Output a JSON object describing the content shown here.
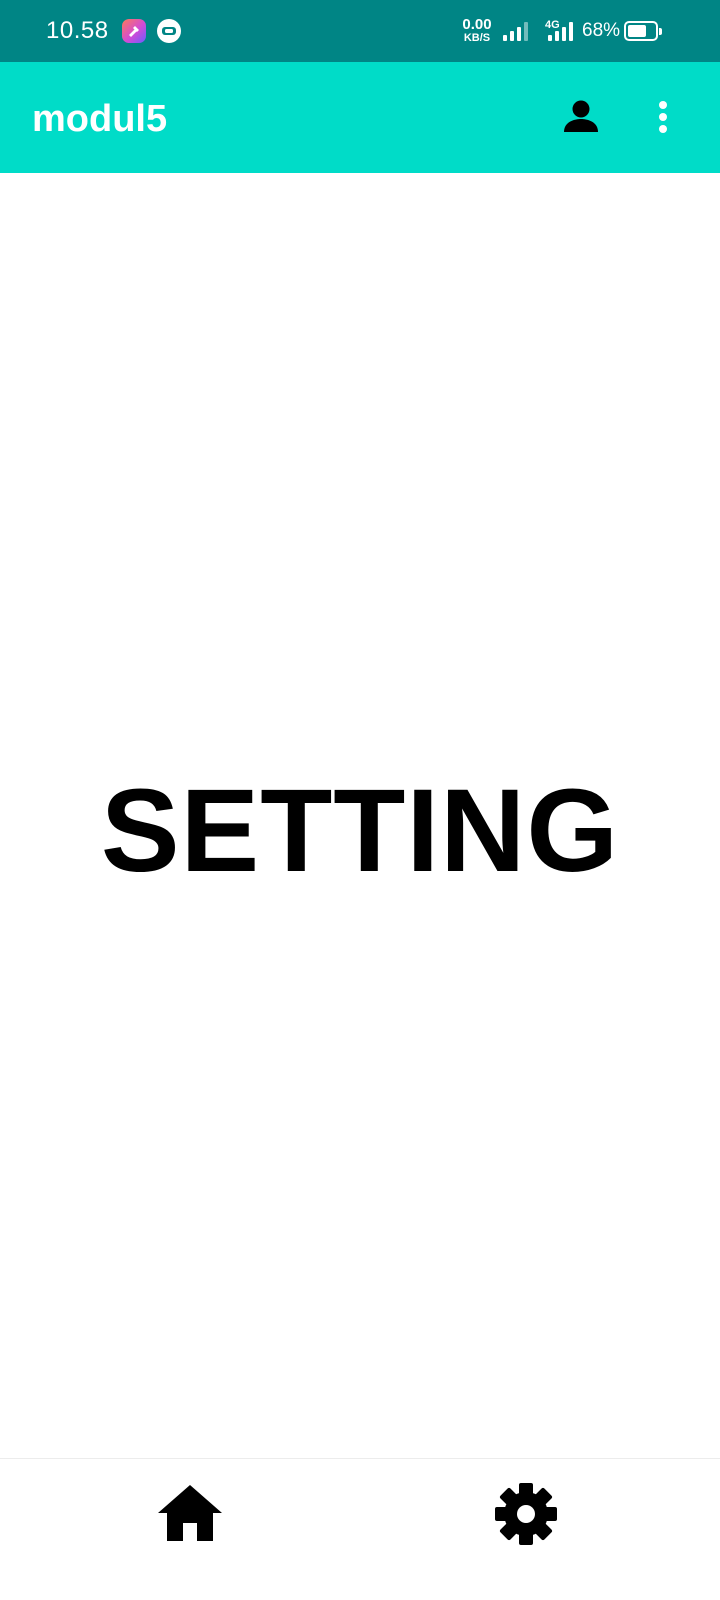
{
  "status_bar": {
    "time": "10.58",
    "net_speed_value": "0.00",
    "net_speed_unit": "KB/S",
    "network_type": "4G",
    "battery_percent": "68%",
    "battery_level": 0.68,
    "icons": [
      "app-notification-icon",
      "messaging-notification-icon",
      "signal-icon",
      "signal-4g-icon",
      "battery-icon"
    ]
  },
  "app_bar": {
    "title": "modul5",
    "actions": [
      "person-icon",
      "more-vert-icon"
    ],
    "color": "#00dcc8"
  },
  "main": {
    "heading": "SETTING"
  },
  "bottom_nav": {
    "items": [
      {
        "icon": "home-icon"
      },
      {
        "icon": "gear-icon"
      }
    ]
  },
  "colors": {
    "status_bar": "#008585",
    "app_bar": "#00dcc8",
    "background": "#ffffff",
    "text": "#000000"
  }
}
